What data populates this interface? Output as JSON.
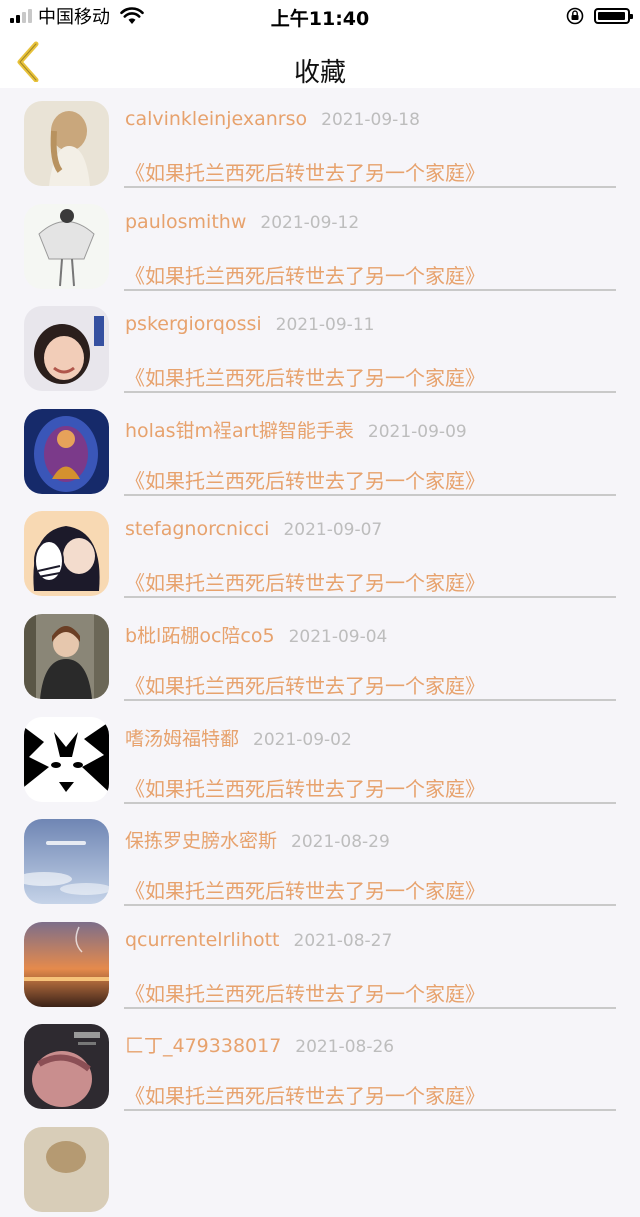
{
  "status_bar": {
    "carrier": "中国移动",
    "time": "上午11:40",
    "battery_level": 0.95
  },
  "nav": {
    "title": "收藏"
  },
  "favorites": [
    {
      "user": "calvinkleinjexanrso",
      "date": "2021-09-18",
      "title": "《如果托兰西死后转世去了另一个家庭》"
    },
    {
      "user": "paulosmithw",
      "date": "2021-09-12",
      "title": "《如果托兰西死后转世去了另一个家庭》"
    },
    {
      "user": "pskergiorqossi",
      "date": "2021-09-11",
      "title": "《如果托兰西死后转世去了另一个家庭》"
    },
    {
      "user": "holas钳m裎art擗智能手表",
      "date": "2021-09-09",
      "title": "《如果托兰西死后转世去了另一个家庭》"
    },
    {
      "user": "stefagnorcnicci",
      "date": "2021-09-07",
      "title": "《如果托兰西死后转世去了另一个家庭》"
    },
    {
      "user": "b枇l跖棚oc陪co5",
      "date": "2021-09-04",
      "title": "《如果托兰西死后转世去了另一个家庭》"
    },
    {
      "user": "嗜汤姆福特鄱",
      "date": "2021-09-02",
      "title": "《如果托兰西死后转世去了另一个家庭》"
    },
    {
      "user": "保拣罗史膀水密斯",
      "date": "2021-08-29",
      "title": "《如果托兰西死后转世去了另一个家庭》"
    },
    {
      "user": "qcurrentelrlihott",
      "date": "2021-08-27",
      "title": "《如果托兰西死后转世去了另一个家庭》"
    },
    {
      "user": "匚丁_479338017",
      "date": "2021-08-26",
      "title": "《如果托兰西死后转世去了另一个家庭》"
    }
  ],
  "colors": {
    "accent": "#e7a26d",
    "date": "#bdbdbd",
    "background": "#f6f5f9",
    "back_arrow": "#e8c23a"
  }
}
